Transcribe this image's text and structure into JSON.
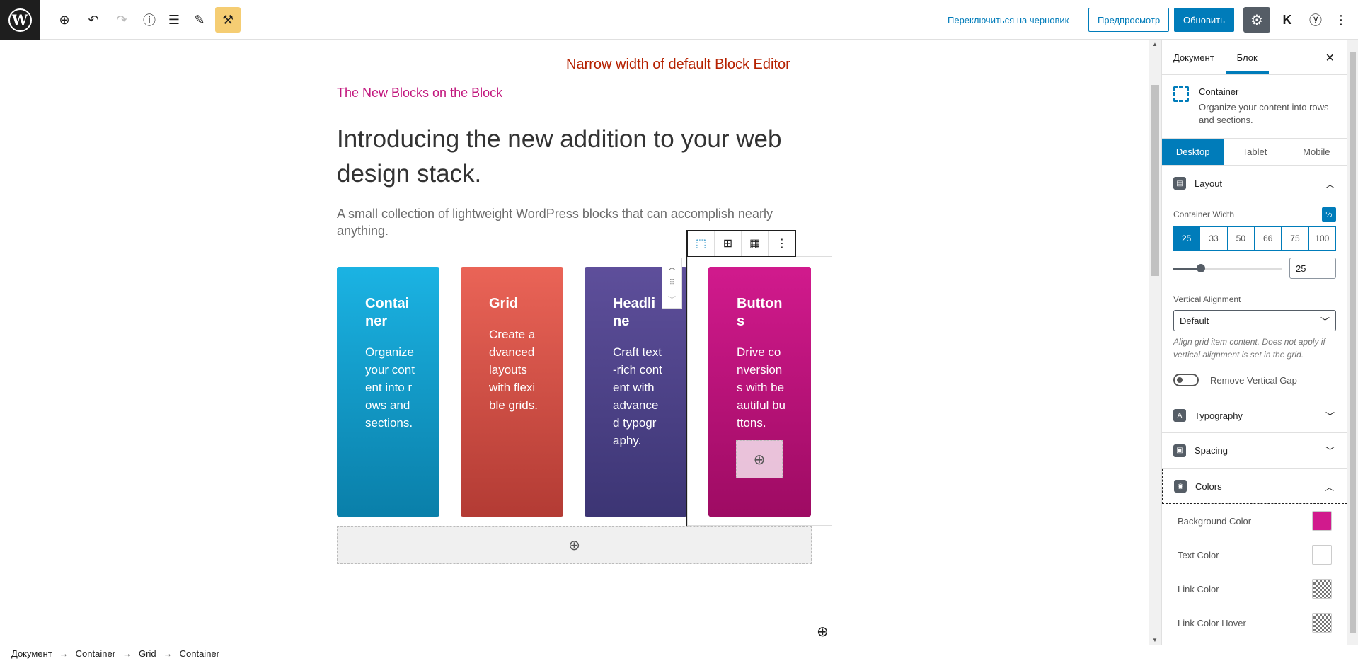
{
  "toolbar": {
    "switch_draft": "Переключиться на черновик",
    "preview": "Предпросмотр",
    "update": "Обновить"
  },
  "canvas": {
    "note": "Narrow width of default Block Editor",
    "kicker": "The New Blocks on the Block",
    "headline": "Introducing the new addition to your web design stack.",
    "sub": "A small collection of lightweight WordPress blocks that can accomplish nearly anything.",
    "cards": [
      {
        "title": "Container",
        "text": "Organize your content into rows and sections."
      },
      {
        "title": "Grid",
        "text": "Create advanced layouts with flexible grids."
      },
      {
        "title": "Headline",
        "text": "Craft text-rich content with advanced typography."
      },
      {
        "title": "Buttons",
        "text": "Drive conversions with beautiful buttons."
      }
    ]
  },
  "breadcrumb": [
    "Документ",
    "Container",
    "Grid",
    "Container"
  ],
  "sidebar": {
    "tabs": [
      "Документ",
      "Блок"
    ],
    "block_name": "Container",
    "block_desc": "Organize your content into rows and sections.",
    "device_tabs": [
      "Desktop",
      "Tablet",
      "Mobile"
    ],
    "layout": {
      "title": "Layout",
      "container_width_label": "Container Width",
      "unit": "%",
      "width_options": [
        "25",
        "33",
        "50",
        "66",
        "75",
        "100"
      ],
      "selected_width": "25",
      "range_value": "25",
      "range_fraction": 0.25,
      "vertical_alignment_label": "Vertical Alignment",
      "vertical_alignment_value": "Default",
      "help": "Align grid item content. Does not apply if vertical alignment is set in the grid.",
      "remove_gap": "Remove Vertical Gap"
    },
    "panels": {
      "typography": "Typography",
      "spacing": "Spacing",
      "colors": "Colors"
    },
    "colors": [
      {
        "label": "Background Color",
        "value": "#d11a8d"
      },
      {
        "label": "Text Color",
        "value": "#ffffff"
      },
      {
        "label": "Link Color",
        "value": ""
      },
      {
        "label": "Link Color Hover",
        "value": ""
      }
    ]
  }
}
